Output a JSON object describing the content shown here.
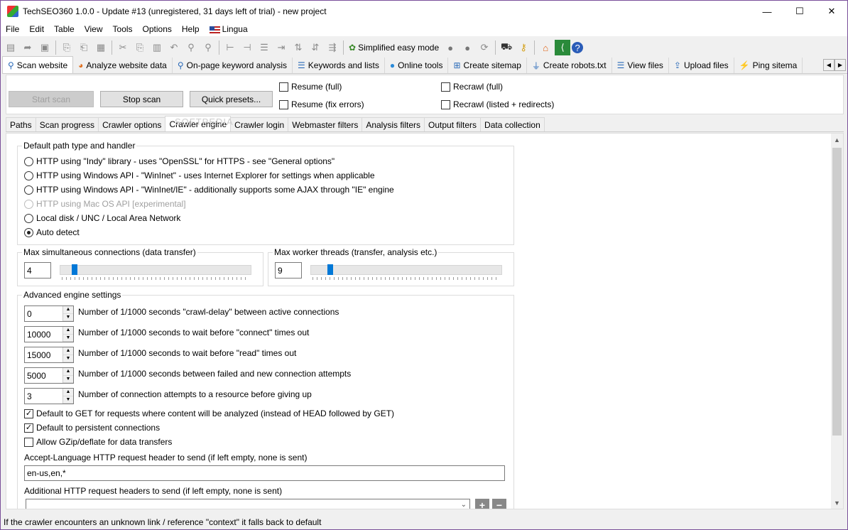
{
  "window": {
    "title": "TechSEO360 1.0.0 - Update #13 (unregistered, 31 days left of trial) - new project",
    "controls": {
      "minimize": "—",
      "maximize": "☐",
      "close": "✕"
    }
  },
  "menu": [
    "File",
    "Edit",
    "Table",
    "View",
    "Tools",
    "Options",
    "Help",
    "Lingua"
  ],
  "toolbar": {
    "simplified_label": "Simplified easy mode"
  },
  "main_tabs": [
    {
      "label": "Scan website",
      "icon": "magnifier-icon"
    },
    {
      "label": "Analyze website data",
      "icon": "chart-icon"
    },
    {
      "label": "On-page keyword analysis",
      "icon": "magnifier-icon"
    },
    {
      "label": "Keywords and lists",
      "icon": "list-icon"
    },
    {
      "label": "Online tools",
      "icon": "globe-icon"
    },
    {
      "label": "Create sitemap",
      "icon": "sitemap-icon"
    },
    {
      "label": "Create robots.txt",
      "icon": "filter-icon"
    },
    {
      "label": "View files",
      "icon": "list-icon"
    },
    {
      "label": "Upload files",
      "icon": "upload-icon"
    },
    {
      "label": "Ping sitema",
      "icon": "lightning-icon"
    }
  ],
  "scan_panel": {
    "start_scan": "Start scan",
    "stop_scan": "Stop scan",
    "quick_presets": "Quick presets...",
    "resume_full": "Resume (full)",
    "resume_fix": "Resume (fix errors)",
    "recrawl_full": "Recrawl (full)",
    "recrawl_listed": "Recrawl (listed + redirects)"
  },
  "sub_tabs": [
    "Paths",
    "Scan progress",
    "Crawler options",
    "Crawler engine",
    "Crawler login",
    "Webmaster filters",
    "Analysis filters",
    "Output filters",
    "Data collection"
  ],
  "path_group": {
    "title": "Default path type and handler",
    "options": [
      {
        "label": "HTTP using \"Indy\" library - uses \"OpenSSL\" for HTTPS - see \"General options\"",
        "selected": false,
        "disabled": false
      },
      {
        "label": "HTTP using Windows API - \"WinInet\" - uses Internet Explorer for settings when applicable",
        "selected": false,
        "disabled": false
      },
      {
        "label": "HTTP using Windows API -  \"WinInet/IE\" - additionally supports some AJAX through \"IE\" engine",
        "selected": false,
        "disabled": false
      },
      {
        "label": "HTTP using Mac OS API [experimental]",
        "selected": false,
        "disabled": true
      },
      {
        "label": "Local disk / UNC / Local Area Network",
        "selected": false,
        "disabled": false
      },
      {
        "label": "Auto detect",
        "selected": true,
        "disabled": false
      }
    ]
  },
  "connections": {
    "title": "Max simultaneous connections (data transfer)",
    "value": "4",
    "level": 0.06
  },
  "threads": {
    "title": "Max worker threads (transfer, analysis etc.)",
    "value": "9",
    "level": 0.09
  },
  "advanced": {
    "title": "Advanced engine settings",
    "spinners": [
      {
        "value": "0",
        "label": "Number of 1/1000 seconds \"crawl-delay\" between active connections"
      },
      {
        "value": "10000",
        "label": "Number of 1/1000 seconds to wait before \"connect\" times out"
      },
      {
        "value": "15000",
        "label": "Number of 1/1000 seconds to wait before \"read\" times out"
      },
      {
        "value": "5000",
        "label": "Number of 1/1000 seconds between failed and new connection attempts"
      },
      {
        "value": "3",
        "label": "Number of connection attempts to a resource before giving up"
      }
    ],
    "checks": [
      {
        "label": "Default to GET for requests where content will be analyzed (instead of HEAD followed by GET)",
        "checked": true
      },
      {
        "label": "Default to persistent connections",
        "checked": true
      },
      {
        "label": "Allow GZip/deflate for data transfers",
        "checked": false
      }
    ],
    "accept_language_label": "Accept-Language HTTP request header to send (if left empty, none is sent)",
    "accept_language_value": "en-us,en,*",
    "additional_headers_label": "Additional HTTP request headers to send (if left empty, none is sent)"
  },
  "watermark": "SOFTPEDIA",
  "status_text": "If the crawler encounters an unknown link / reference \"context\" it falls back to default"
}
